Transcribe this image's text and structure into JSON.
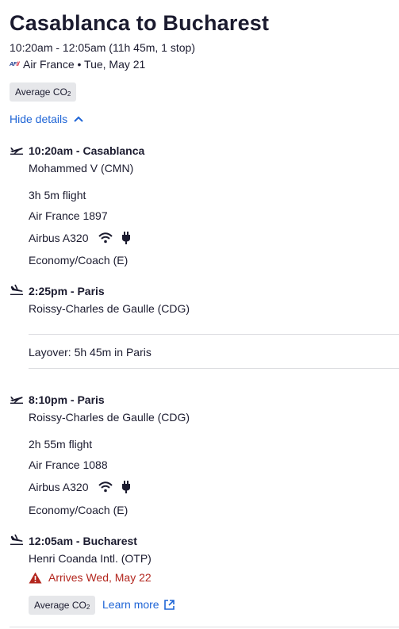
{
  "title": "Casablanca to Bucharest",
  "summary": "10:20am - 12:05am (11h 45m, 1 stop)",
  "airline_line": "Air France • Tue, May 21",
  "airline_logo_text": "AF",
  "co2_label": "Average CO",
  "co2_sub": "2",
  "hide_details": "Hide details",
  "segments": [
    {
      "depart_time": "10:20am - Casablanca",
      "depart_airport": "Mohammed V (CMN)",
      "duration": "3h 5m flight",
      "flight": "Air France 1897",
      "aircraft": "Airbus A320",
      "cabin": "Economy/Coach (E)",
      "arrive_time": "2:25pm - Paris",
      "arrive_airport": "Roissy-Charles de Gaulle (CDG)"
    },
    {
      "depart_time": "8:10pm - Paris",
      "depart_airport": "Roissy-Charles de Gaulle (CDG)",
      "duration": "2h 55m flight",
      "flight": "Air France 1088",
      "aircraft": "Airbus A320",
      "cabin": "Economy/Coach (E)",
      "arrive_time": "12:05am - Bucharest",
      "arrive_airport": "Henri Coanda Intl. (OTP)"
    }
  ],
  "layover": "Layover: 5h 45m in Paris",
  "arrival_warning": "Arrives Wed, May 22",
  "learn_more": "Learn more",
  "colors": {
    "link": "#1f65d6",
    "warning": "#b3261e",
    "badge_bg": "#e6e7ea",
    "text": "#1b1b2f"
  },
  "icons": [
    "takeoff-icon",
    "landing-icon",
    "wifi-icon",
    "power-plug-icon",
    "chevron-up-icon",
    "warning-icon",
    "external-link-icon"
  ]
}
